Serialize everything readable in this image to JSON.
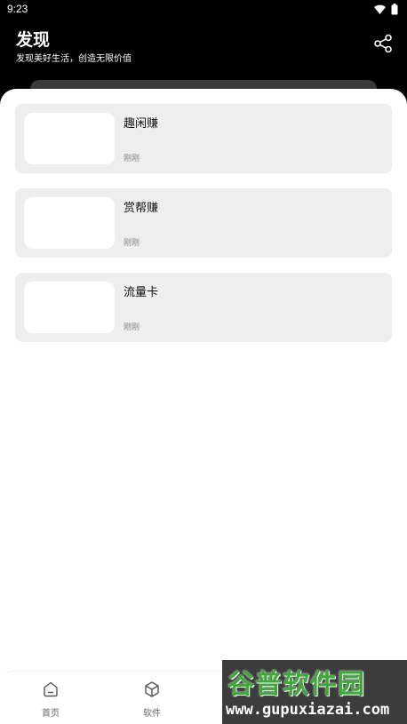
{
  "status_bar": {
    "time": "9:23",
    "icons": [
      "wifi-icon",
      "battery-icon"
    ]
  },
  "header": {
    "title": "发现",
    "subtitle": "发现美好生活，创造无限价值",
    "share_icon": "share-icon"
  },
  "cards": [
    {
      "name": "趣闲赚",
      "time": "刚刚"
    },
    {
      "name": "赏帮赚",
      "time": "刚刚"
    },
    {
      "name": "流量卡",
      "time": "刚刚"
    }
  ],
  "tabbar": {
    "tabs": [
      {
        "label": "首页",
        "icon": "home-icon"
      },
      {
        "label": "软件",
        "icon": "cube-icon"
      }
    ]
  },
  "watermark": {
    "text": "谷普软件园",
    "url": "www.gupuxiazai.com"
  },
  "colors": {
    "header_bg": "#000000",
    "card_bg": "#eeeeee",
    "watermark_green": "#3fa83a"
  }
}
